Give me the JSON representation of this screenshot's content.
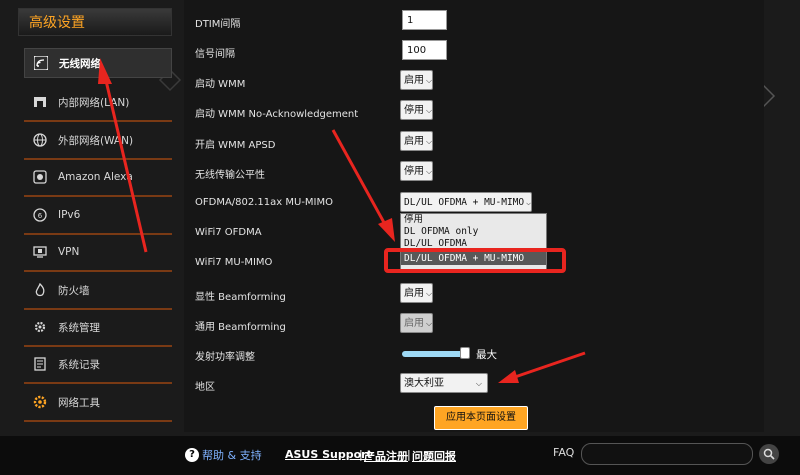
{
  "sidebar": {
    "title": "高级设置",
    "items": [
      {
        "label": "无线网络",
        "icon": "wifi-icon"
      },
      {
        "label": "内部网络(LAN)",
        "icon": "home-lan-icon"
      },
      {
        "label": "外部网络(WAN)",
        "icon": "globe-icon"
      },
      {
        "label": "Amazon Alexa",
        "icon": "alexa-icon"
      },
      {
        "label": "IPv6",
        "icon": "ipv6-icon"
      },
      {
        "label": "VPN",
        "icon": "vpn-icon"
      },
      {
        "label": "防火墙",
        "icon": "firewall-icon"
      },
      {
        "label": "系统管理",
        "icon": "admin-gear-icon"
      },
      {
        "label": "系统记录",
        "icon": "log-icon"
      },
      {
        "label": "网络工具",
        "icon": "tools-gear-icon"
      }
    ]
  },
  "settings": {
    "dtim": {
      "label": "DTIM间隔",
      "value": "1"
    },
    "beacon": {
      "label": "信号间隔",
      "value": "100"
    },
    "wmm": {
      "label": "启动 WMM",
      "value": "启用"
    },
    "wmm_noack": {
      "label": "启动 WMM No-Acknowledgement",
      "value": "停用"
    },
    "wmm_apsd": {
      "label": "开启 WMM APSD",
      "value": "启用"
    },
    "airtime": {
      "label": "无线传输公平性",
      "value": "停用"
    },
    "ofdma": {
      "label": "OFDMA/802.11ax MU-MIMO",
      "value": "DL/UL OFDMA + MU-MIMO"
    },
    "wifi7_ofdma": {
      "label": "WiFi7 OFDMA"
    },
    "wifi7_mumimo": {
      "label": "WiFi7 MU-MIMO"
    },
    "explicit_bf": {
      "label": "显性 Beamforming",
      "value": "启用"
    },
    "universal_bf": {
      "label": "通用 Beamforming",
      "value": "启用"
    },
    "tx_power": {
      "label": "发射功率调整",
      "max_label": "最大",
      "level": 1.0
    },
    "region": {
      "label": "地区",
      "value": "澳大利亚"
    }
  },
  "dropdown": {
    "options": [
      "停用",
      "DL OFDMA only",
      "DL/UL OFDMA",
      "DL/UL OFDMA + MU-MIMO"
    ],
    "selected": "DL/UL OFDMA + MU-MIMO"
  },
  "apply_label": "应用本页面设置",
  "footer": {
    "help": "帮助 & 支持",
    "links": [
      "ASUS Support",
      "产品注册",
      "问题回报"
    ],
    "separator": "|",
    "faq": "FAQ"
  },
  "colors": {
    "accent": "#ffa523",
    "annotation": "#e8251f"
  }
}
